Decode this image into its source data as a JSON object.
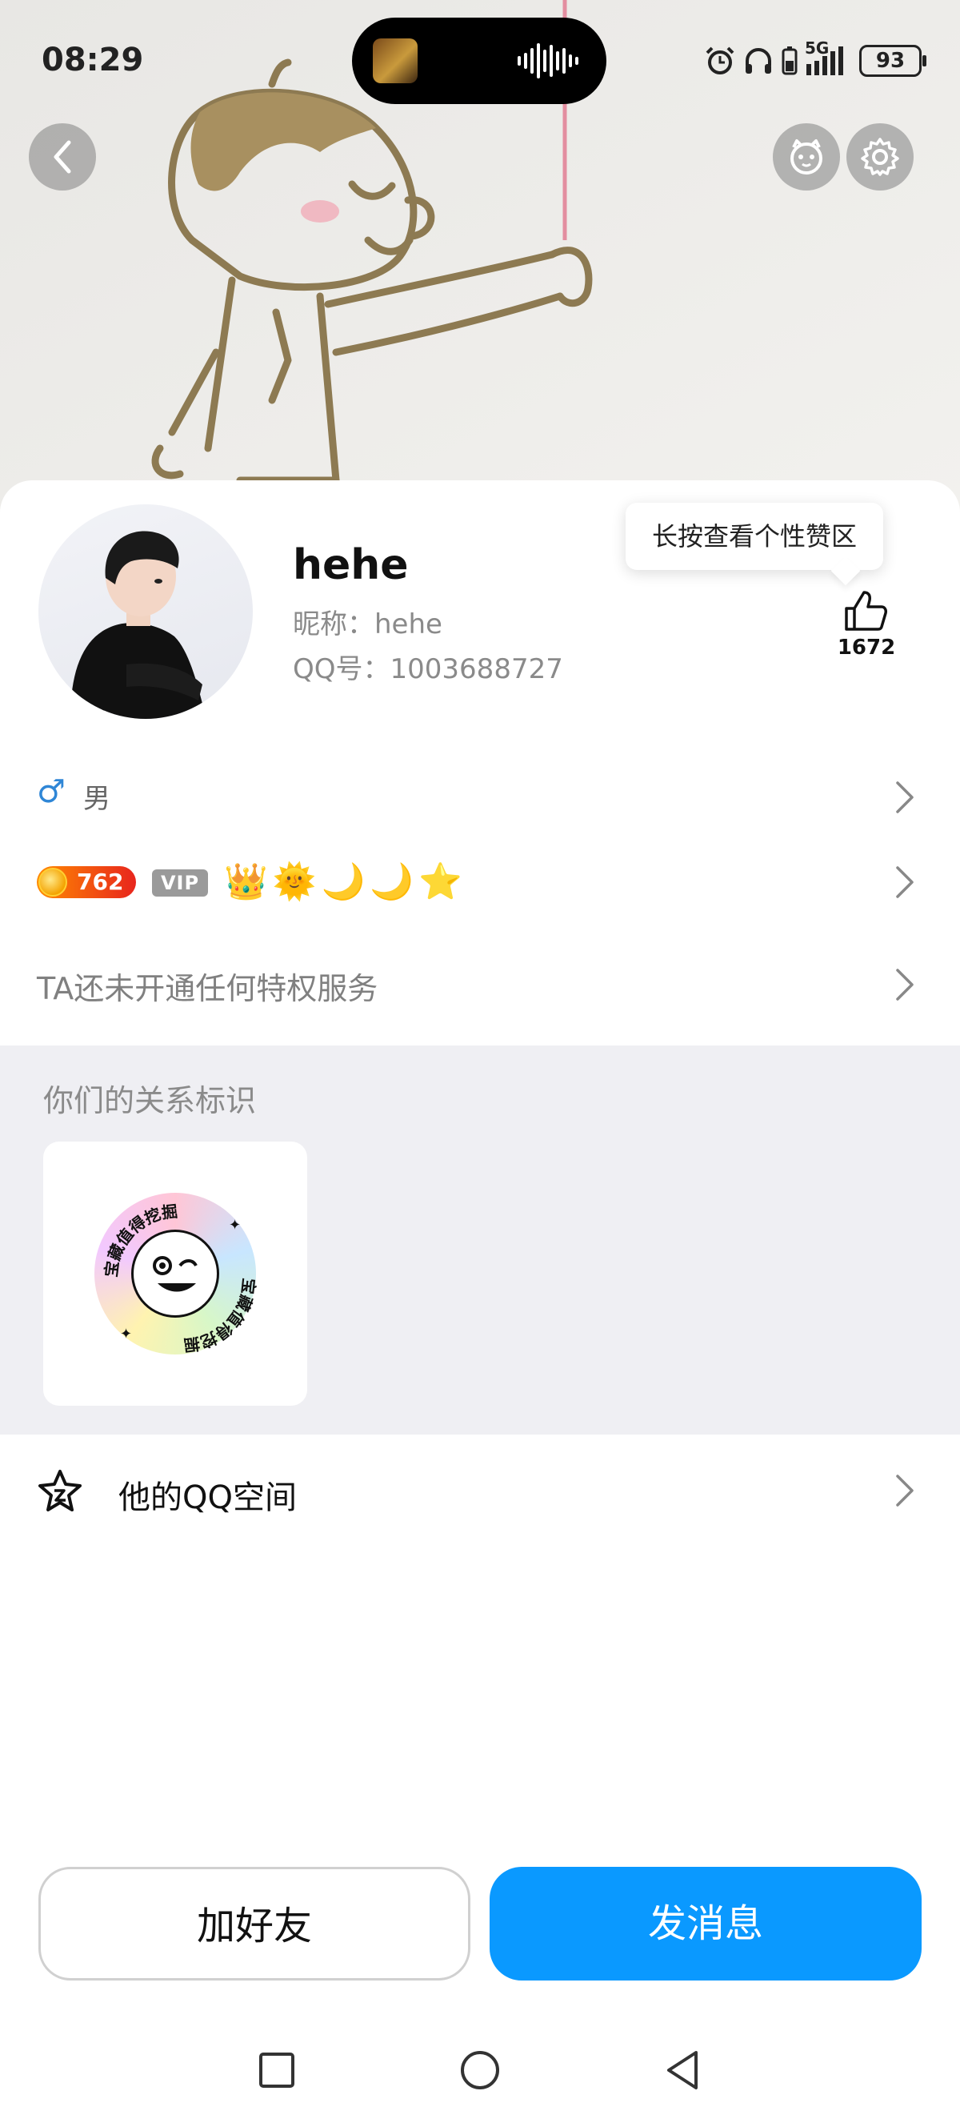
{
  "status_bar": {
    "time": "08:29",
    "network": "5G",
    "battery": "93",
    "icons": [
      "alarm-icon",
      "headphones-icon",
      "battery-saver-icon",
      "signal-icon",
      "battery-icon"
    ]
  },
  "header": {
    "back_icon": "chevron-left-icon",
    "pet_icon": "pet-face-icon",
    "settings_icon": "gear-icon"
  },
  "profile": {
    "username": "hehe",
    "nickname": "昵称：hehe",
    "qq_number": "QQ号：1003688727",
    "like_tooltip": "长按查看个性赞区",
    "like_count": "1672"
  },
  "info_rows": {
    "gender_symbol": "♂",
    "gender": "男",
    "level_number": "762",
    "vip_label": "VIP",
    "level_icons": [
      "crown-icon",
      "sun-icon",
      "moon-icon",
      "moon-icon",
      "star-icon"
    ],
    "privilege_text": "TA还未开通任何特权服务"
  },
  "relationship": {
    "title": "你们的关系标识",
    "badge_text": "宝藏值得挖掘"
  },
  "qq_zone": {
    "label": "他的QQ空间"
  },
  "actions": {
    "add_friend": "加好友",
    "send_message": "发消息"
  },
  "colors": {
    "primary_blue": "#0a99ff",
    "level_badge": "#e8251d",
    "gender_blue": "#2f86d6",
    "section_bg": "#efeff3"
  }
}
